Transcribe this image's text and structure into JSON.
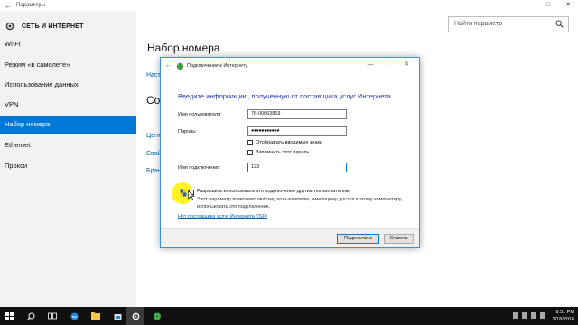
{
  "window": {
    "title": "Параметры"
  },
  "sidebar": {
    "header": "СЕТЬ И ИНТЕРНЕТ",
    "items": [
      {
        "label": "Wi-Fi"
      },
      {
        "label": "Режим «в самолете»"
      },
      {
        "label": "Использование данных"
      },
      {
        "label": "VPN"
      },
      {
        "label": "Набор номера",
        "active": true
      },
      {
        "label": "Ethernet"
      },
      {
        "label": "Прокси"
      }
    ]
  },
  "search": {
    "placeholder": "Найти параметр"
  },
  "main": {
    "title": "Набор номера",
    "link1": "Наст",
    "subtitle": "Со",
    "links": [
      "Цент",
      "Свой",
      "Бран"
    ]
  },
  "dialog": {
    "title": "Подключение к Интернету",
    "heading": "Введите информацию, полученную от поставщика услуг Интернета",
    "username_label": "Имя пользователя:",
    "username_value": "76-00663869",
    "password_label": "Пароль:",
    "password_value": "●●●●●●●●●●●",
    "show_chars_label": "Отображать вводимые знаки",
    "remember_label": "Запомнить этот пароль",
    "connname_label": "Имя подключения:",
    "connname_value": "123",
    "share_label": "Разрешить использовать это подключение другим пользователям",
    "share_desc": "Этот параметр позволяет любому пользователю, имеющему доступ к этому компьютеру, использовать это подключение.",
    "isp_link": "Нет поставщика услуг Интернета (ISP)",
    "connect_button": "Подключить",
    "cancel_button": "Отмена"
  },
  "taskbar": {
    "time": "8:51 PM",
    "date": "2/18/2016"
  },
  "colors": {
    "accent": "#0078d7",
    "heading": "#1e3c9e",
    "link": "#0063b1"
  }
}
